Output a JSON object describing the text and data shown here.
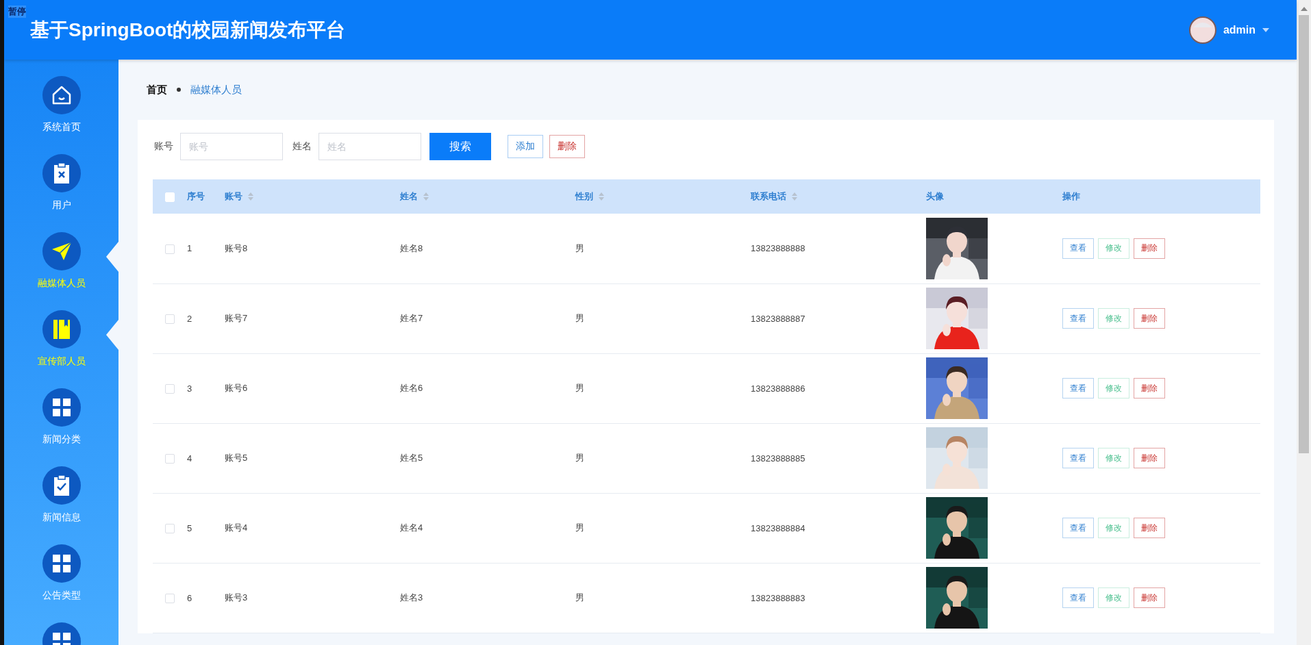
{
  "overlay_label": "暂停",
  "header": {
    "title": "基于SpringBoot的校园新闻发布平台",
    "user": "admin"
  },
  "sidebar": {
    "items": [
      {
        "label": "系统首页",
        "kind": "home",
        "highlighted": false
      },
      {
        "label": "用户",
        "kind": "users",
        "highlighted": false
      },
      {
        "label": "融媒体人员",
        "kind": "media",
        "highlighted": true
      },
      {
        "label": "宣传部人员",
        "kind": "publicity",
        "highlighted": true
      },
      {
        "label": "新闻分类",
        "kind": "category",
        "highlighted": false
      },
      {
        "label": "新闻信息",
        "kind": "news",
        "highlighted": false
      },
      {
        "label": "公告类型",
        "kind": "category",
        "highlighted": false
      },
      {
        "kind": "category",
        "highlighted": false
      }
    ]
  },
  "breadcrumb": [
    "首页",
    "融媒体人员"
  ],
  "search": {
    "fields": [
      {
        "label": "账号",
        "placeholder": "账号"
      },
      {
        "label": "姓名",
        "placeholder": "姓名"
      }
    ],
    "buttons": [
      {
        "label": "搜索",
        "kind": "search"
      },
      {
        "label": "添加",
        "kind": "add"
      },
      {
        "label": "删除",
        "kind": "delete"
      }
    ]
  },
  "table": {
    "all_checked": false,
    "columns": [
      {
        "label": "序号",
        "sortable": false
      },
      {
        "label": "账号",
        "sortable": true
      },
      {
        "label": "姓名",
        "sortable": true
      },
      {
        "label": "性别",
        "sortable": true
      },
      {
        "label": "联系电话",
        "sortable": true
      },
      {
        "label": "头像",
        "sortable": false
      },
      {
        "label": "操作",
        "sortable": false
      }
    ],
    "rows": [
      {
        "checked": false,
        "index": "1",
        "account": "账号8",
        "name": "姓名8",
        "gender": "男",
        "phone": "13823888888",
        "actions": [
          {
            "label": "查看",
            "kind": "view"
          },
          {
            "label": "修改",
            "kind": "edit"
          },
          {
            "label": "删除",
            "kind": "delete"
          }
        ]
      },
      {
        "checked": false,
        "index": "2",
        "account": "账号7",
        "name": "姓名7",
        "gender": "男",
        "phone": "13823888887",
        "actions": [
          {
            "label": "查看",
            "kind": "view"
          },
          {
            "label": "修改",
            "kind": "edit"
          },
          {
            "label": "删除",
            "kind": "delete"
          }
        ]
      },
      {
        "checked": false,
        "index": "3",
        "account": "账号6",
        "name": "姓名6",
        "gender": "男",
        "phone": "13823888886",
        "actions": [
          {
            "label": "查看",
            "kind": "view"
          },
          {
            "label": "修改",
            "kind": "edit"
          },
          {
            "label": "删除",
            "kind": "delete"
          }
        ]
      },
      {
        "checked": false,
        "index": "4",
        "account": "账号5",
        "name": "姓名5",
        "gender": "男",
        "phone": "13823888885",
        "actions": [
          {
            "label": "查看",
            "kind": "view"
          },
          {
            "label": "修改",
            "kind": "edit"
          },
          {
            "label": "删除",
            "kind": "delete"
          }
        ]
      },
      {
        "checked": false,
        "index": "5",
        "account": "账号4",
        "name": "姓名4",
        "gender": "男",
        "phone": "13823888884",
        "actions": [
          {
            "label": "查看",
            "kind": "view"
          },
          {
            "label": "修改",
            "kind": "edit"
          },
          {
            "label": "删除",
            "kind": "delete"
          }
        ]
      },
      {
        "checked": false,
        "index": "6",
        "account": "账号3",
        "name": "姓名3",
        "gender": "男",
        "phone": "13823888883",
        "actions": [
          {
            "label": "查看",
            "kind": "view"
          },
          {
            "label": "修改",
            "kind": "edit"
          },
          {
            "label": "删除",
            "kind": "delete"
          }
        ]
      }
    ]
  }
}
